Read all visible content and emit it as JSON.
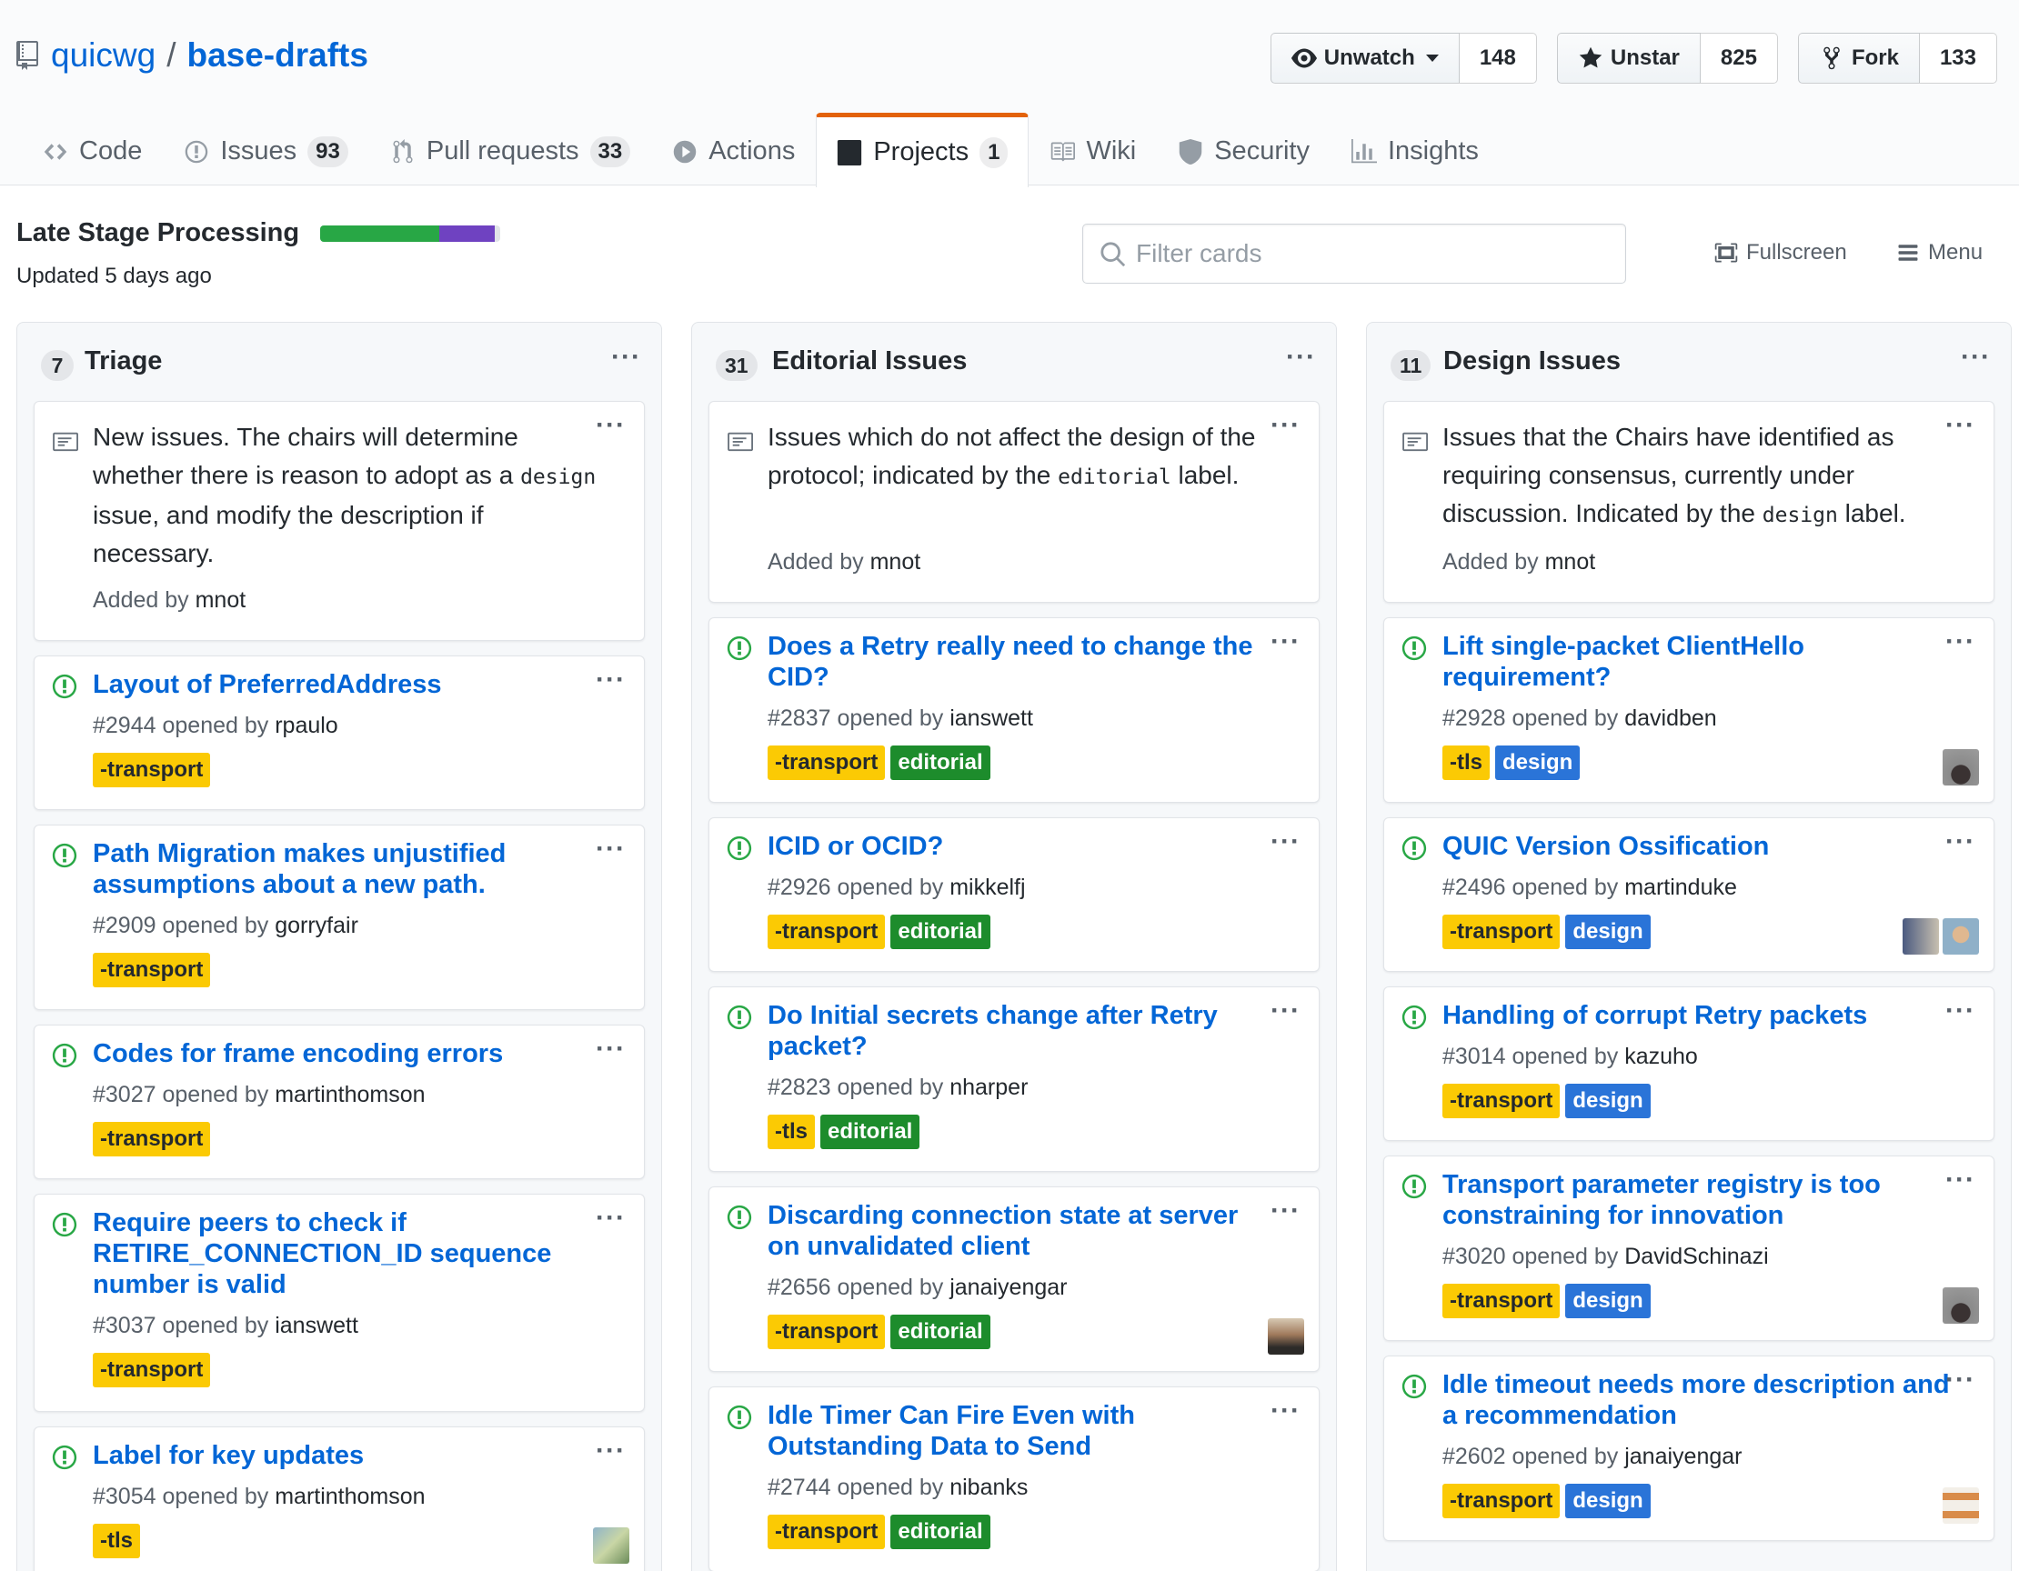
{
  "repo": {
    "owner": "quicwg",
    "separator": "/",
    "name": "base-drafts"
  },
  "actions": {
    "watch": {
      "label": "Unwatch",
      "count": "148"
    },
    "star": {
      "label": "Unstar",
      "count": "825"
    },
    "fork": {
      "label": "Fork",
      "count": "133"
    }
  },
  "nav": {
    "code": {
      "label": "Code"
    },
    "issues": {
      "label": "Issues",
      "count": "93"
    },
    "pulls": {
      "label": "Pull requests",
      "count": "33"
    },
    "actions": {
      "label": "Actions"
    },
    "projects": {
      "label": "Projects",
      "count": "1"
    },
    "wiki": {
      "label": "Wiki"
    },
    "security": {
      "label": "Security"
    },
    "insights": {
      "label": "Insights"
    }
  },
  "project": {
    "name": "Late Stage Processing",
    "updated": "Updated 5 days ago",
    "progress": {
      "done_fraction": 0.66,
      "in_progress_fraction": 0.31
    },
    "filter_placeholder": "Filter cards",
    "fullscreen_label": "Fullscreen",
    "menu_label": "Menu"
  },
  "columns": [
    {
      "count": "7",
      "title": "Triage",
      "note": {
        "parts": [
          "New issues. The chairs will determine whether there is reason to adopt as a ",
          "design",
          " issue, and modify the description if necessary."
        ],
        "added_prefix": "Added by",
        "added_by": "mnot"
      },
      "cards": [
        {
          "title": "Layout of PreferredAddress",
          "number": "#2944",
          "opened_text": "opened by",
          "author": "rpaulo",
          "labels": [
            "-transport"
          ]
        },
        {
          "title": "Path Migration makes unjustified assumptions about a new path.",
          "number": "#2909",
          "opened_text": "opened by",
          "author": "gorryfair",
          "labels": [
            "-transport"
          ]
        },
        {
          "title": "Codes for frame encoding errors",
          "number": "#3027",
          "opened_text": "opened by",
          "author": "martinthomson",
          "labels": [
            "-transport"
          ]
        },
        {
          "title": "Require peers to check if RETIRE_CONNECTION_ID sequence number is valid",
          "number": "#3037",
          "opened_text": "opened by",
          "author": "ianswett",
          "labels": [
            "-transport"
          ]
        },
        {
          "title": "Label for key updates",
          "number": "#3054",
          "opened_text": "opened by",
          "author": "martinthomson",
          "labels": [
            "-tls"
          ]
        }
      ]
    },
    {
      "count": "31",
      "title": "Editorial Issues",
      "note": {
        "parts": [
          "Issues which do not affect the design of the protocol; indicated by the ",
          "editorial",
          " label."
        ],
        "added_prefix": "Added by",
        "added_by": "mnot"
      },
      "cards": [
        {
          "title": "Does a Retry really need to change the CID?",
          "number": "#2837",
          "opened_text": "opened by",
          "author": "ianswett",
          "labels": [
            "-transport",
            "editorial"
          ]
        },
        {
          "title": "ICID or OCID?",
          "number": "#2926",
          "opened_text": "opened by",
          "author": "mikkelfj",
          "labels": [
            "-transport",
            "editorial"
          ]
        },
        {
          "title": "Do Initial secrets change after Retry packet?",
          "number": "#2823",
          "opened_text": "opened by",
          "author": "nharper",
          "labels": [
            "-tls",
            "editorial"
          ]
        },
        {
          "title": "Discarding connection state at server on unvalidated client",
          "number": "#2656",
          "opened_text": "opened by",
          "author": "janaiyengar",
          "labels": [
            "-transport",
            "editorial"
          ]
        },
        {
          "title": "Idle Timer Can Fire Even with Outstanding Data to Send",
          "number": "#2744",
          "opened_text": "opened by",
          "author": "nibanks",
          "labels": [
            "-transport",
            "editorial"
          ]
        }
      ]
    },
    {
      "count": "11",
      "title": "Design Issues",
      "note": {
        "parts": [
          "Issues that the Chairs have identified as requiring consensus, currently under discussion. Indicated by the ",
          "design",
          " label."
        ],
        "added_prefix": "Added by",
        "added_by": "mnot"
      },
      "cards": [
        {
          "title": "Lift single-packet ClientHello requirement?",
          "number": "#2928",
          "opened_text": "opened by",
          "author": "davidben",
          "labels": [
            "-tls",
            "design"
          ]
        },
        {
          "title": "QUIC Version Ossification",
          "number": "#2496",
          "opened_text": "opened by",
          "author": "martinduke",
          "labels": [
            "-transport",
            "design"
          ]
        },
        {
          "title": "Handling of corrupt Retry packets",
          "number": "#3014",
          "opened_text": "opened by",
          "author": "kazuho",
          "labels": [
            "-transport",
            "design"
          ]
        },
        {
          "title": "Transport parameter registry is too constraining for innovation",
          "number": "#3020",
          "opened_text": "opened by",
          "author": "DavidSchinazi",
          "labels": [
            "-transport",
            "design"
          ]
        },
        {
          "title": "Idle timeout needs more description and a recommendation",
          "number": "#2602",
          "opened_text": "opened by",
          "author": "janaiyengar",
          "labels": [
            "-transport",
            "design"
          ]
        }
      ]
    }
  ],
  "colors": {
    "link": "#0366d6",
    "open_issue": "#28a745",
    "label_transport": "#fbca04",
    "label_editorial": "#1d8c2c",
    "label_design": "#2a74d8",
    "selected_tab_accent": "#e36209"
  },
  "icons": [
    "repo-icon",
    "eye-icon",
    "star-icon",
    "fork-icon",
    "code-icon",
    "issue-icon",
    "pull-request-icon",
    "play-icon",
    "project-icon",
    "book-icon",
    "shield-icon",
    "graph-icon",
    "search-icon",
    "screen-full-icon",
    "menu-icon",
    "note-icon",
    "issue-opened-icon",
    "kebab-icon"
  ]
}
